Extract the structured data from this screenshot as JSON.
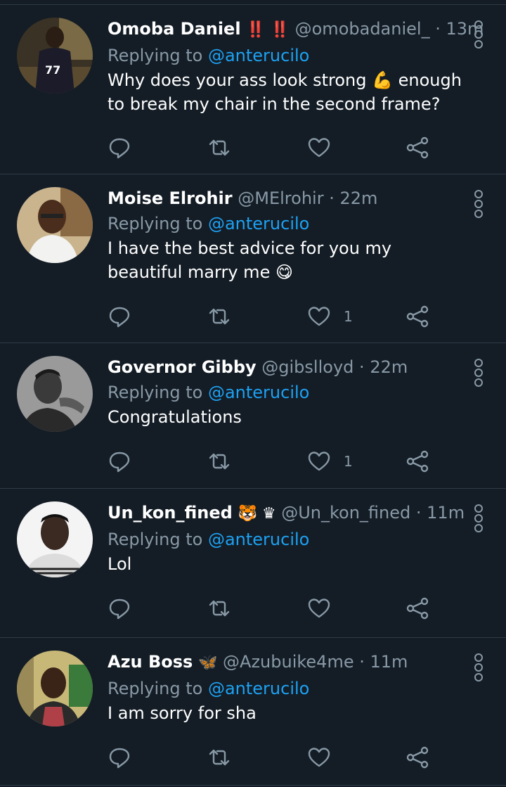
{
  "colors": {
    "background": "#141d26",
    "secondary_text": "#8899a6",
    "accent": "#1da1f2"
  },
  "replying_prefix": "Replying to",
  "tweets": [
    {
      "name": "Omoba Daniel",
      "emoji": "‼️ ‼️",
      "handle": "@omobadaniel_",
      "time": "13m",
      "reply_to": "@anterucilo",
      "text": "Why does your ass look strong 💪 enough to break my chair in the second frame?",
      "likes": ""
    },
    {
      "name": "Moise Elrohir",
      "emoji": "",
      "handle": "@MElrohir",
      "time": "22m",
      "reply_to": "@anterucilo",
      "text": "I have the best advice for you my beautiful marry me 😋",
      "likes": "1"
    },
    {
      "name": "Governor Gibby",
      "emoji": "",
      "handle": "@gibslloyd",
      "time": "22m",
      "reply_to": "@anterucilo",
      "text": "Congratulations",
      "likes": "1"
    },
    {
      "name": "Un_kon_fined",
      "emoji": "🐯 ♛",
      "handle": "@Un_kon_fined",
      "time": "11m",
      "reply_to": "@anterucilo",
      "text": "Lol",
      "likes": ""
    },
    {
      "name": "Azu Boss",
      "emoji": "🦋",
      "handle": "@Azubuike4me",
      "time": "11m",
      "reply_to": "@anterucilo",
      "text": "I am sorry for sha",
      "likes": ""
    }
  ]
}
